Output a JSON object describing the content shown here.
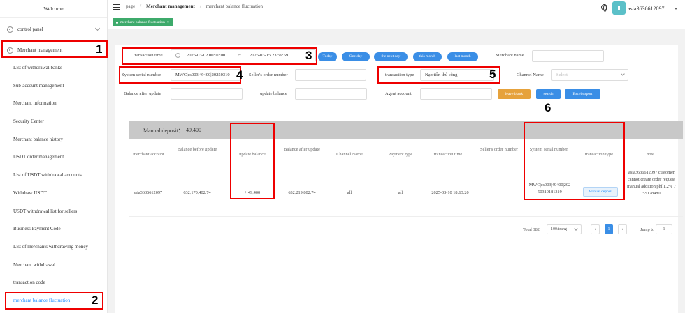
{
  "sidebar": {
    "welcome": "Welcome",
    "control_panel": "control panel",
    "merchant_management": "Merchant management",
    "items": [
      {
        "label": "List of withdrawal banks"
      },
      {
        "label": "Sub-account management"
      },
      {
        "label": "Merchant information"
      },
      {
        "label": "Security Center"
      },
      {
        "label": "Merchant balance history"
      },
      {
        "label": "USDT order management"
      },
      {
        "label": "List of USDT withdrawal accounts"
      },
      {
        "label": "Withdraw USDT"
      },
      {
        "label": "USDT withdrawal list for sellers"
      },
      {
        "label": "Business Payment Code"
      },
      {
        "label": "List of merchants withdrawing money"
      },
      {
        "label": "Merchant withdrawal"
      },
      {
        "label": "transaction code"
      },
      {
        "label": "merchant balance fluctuation"
      }
    ]
  },
  "header": {
    "breadcrumb": [
      "page",
      "Merchant management",
      "merchant balance fluctuation"
    ],
    "username": "asia3636612097"
  },
  "tabs": [
    {
      "label": "merchant balance fluctuation"
    }
  ],
  "form": {
    "transaction_time_label": "transaction time",
    "start_time": "2025-03-02 00:00:00",
    "range_sep": "~",
    "end_time": "2025-03-15 23:59:59",
    "quick_buttons": [
      "Today",
      "One day",
      "the next day",
      "this month",
      "last month"
    ],
    "merchant_name_label": "Merchant name",
    "merchant_name_value": "",
    "system_serial_label": "System serial number",
    "system_serial_value": "MWC|cs003|49400|20250310",
    "seller_order_label": "Seller's order number",
    "seller_order_value": "",
    "transaction_type_label": "transaction type",
    "transaction_type_value": "Nạp tiền thủ công",
    "channel_name_label": "Channel Name",
    "channel_name_placeholder": "Select",
    "balance_after_label": "Balance after update",
    "update_balance_label": "update balance",
    "agent_account_label": "Agent account",
    "leave_blank": "leave blank",
    "search": "search",
    "excel_export": "Excel export"
  },
  "summary": {
    "label": "Manual deposit：",
    "value": "49,400"
  },
  "table": {
    "headers": [
      "merchant account",
      "Balance before update",
      "update balance",
      "Balance after update",
      "Channel Name",
      "Payment type",
      "transaction time",
      "Seller's order number",
      "System serial number",
      "transaction type",
      "note"
    ],
    "rows": [
      {
        "merchant_account": "asia3636612097",
        "balance_before": "632,170,402.74",
        "update_balance": "+ 49,400",
        "balance_after": "632,219,802.74",
        "channel_name": "all",
        "payment_type": "all",
        "transaction_time": "2025-03-10 18:13:20",
        "seller_order": "",
        "system_serial": "MWC|cs003|49400|20250310181319",
        "transaction_type": "Manual deposit",
        "note": "asia3636612097 customer cannot create order request manual addition phí 1.2% 755178480"
      }
    ]
  },
  "pager": {
    "total": "Total 382",
    "page_size": "100/trang",
    "current": "1",
    "jump_label": "Jump to",
    "jump_value": "1"
  },
  "callouts": [
    "1",
    "2",
    "3",
    "4",
    "5",
    "6"
  ],
  "colors": {
    "primary": "#3a8ee6",
    "tab_green": "#3daa6b",
    "leave_blank": "#e6a23c",
    "annotation_red": "#e00000"
  }
}
